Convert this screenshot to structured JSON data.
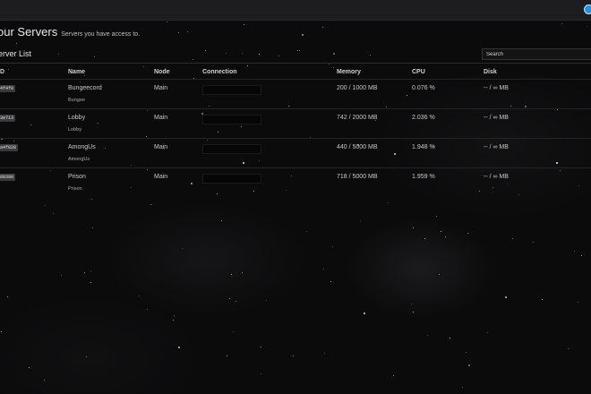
{
  "header": {
    "title": "our Servers",
    "subtitle": "Servers you have access to."
  },
  "panel": {
    "title": "erver List",
    "search_placeholder": "Search"
  },
  "table": {
    "columns": [
      "D",
      "Name",
      "Node",
      "Connection",
      "Memory",
      "CPU",
      "Disk"
    ],
    "rows": [
      {
        "id": "de4f4f0",
        "name": "Bungeecord",
        "desc": "Bungee",
        "node": "Main",
        "memory": "200 / 1000 MB",
        "cpu": "0.076 %",
        "disk": "-- / ∞ MB"
      },
      {
        "id": "8c3e713",
        "name": "Lobby",
        "desc": "Lobby",
        "node": "Main",
        "memory": "742 / 2000 MB",
        "cpu": "2.036 %",
        "disk": "-- / ∞ MB"
      },
      {
        "id": "f6a4f828",
        "name": "AmongUs",
        "desc": "AmongUs",
        "node": "Main",
        "memory": "440 / 5000 MB",
        "cpu": "1.948 %",
        "disk": "-- / ∞ MB"
      },
      {
        "id": "f989398",
        "name": "Prison",
        "desc": "Prison",
        "node": "Main",
        "memory": "718 / 5000 MB",
        "cpu": "1.959 %",
        "disk": "-- / ∞ MB"
      }
    ]
  },
  "colors": {
    "topbar": "#1d1d1f",
    "background": "#0b0b0c",
    "badge": "#3a3a3c",
    "user_icon": "#2a8fd8"
  },
  "icons": {
    "user": "user-avatar-icon"
  }
}
